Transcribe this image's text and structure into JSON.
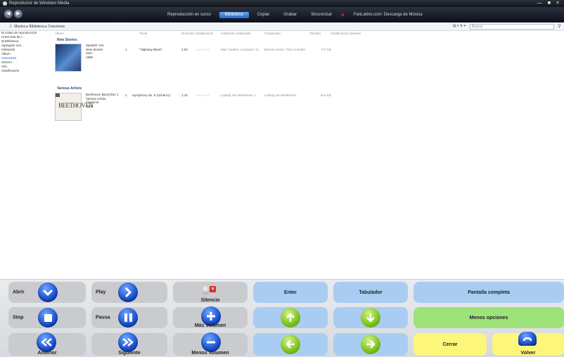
{
  "window": {
    "title": "Reproductor de Windows Media",
    "controls": "— ■ ×"
  },
  "nav": {
    "back": "◀",
    "forward": "▶",
    "tabs": [
      "Reproducción en curso",
      "Biblioteca",
      "Copiar",
      "Grabar",
      "Sincronizar"
    ],
    "active_tab": "Biblioteca",
    "store": "FanLatino.com: Descarga de Música"
  },
  "address": {
    "crumbs": "Música  ▸  Biblioteca  ▸  Canciones",
    "search_placeholder": "Buscar",
    "view_controls": "▤ ▾  ⇅ ▾"
  },
  "tree": {
    "items": [
      "⊟ Listas de reproducción",
      "   Crear lista de r...",
      "⊟ Biblioteca",
      "   Agregado reci...",
      "   Intérprete",
      "   Álbum",
      "   Canciones",
      "   Género",
      "   Año",
      "   Clasificación"
    ]
  },
  "columns": [
    "Álbum",
    "Título",
    "Duración",
    "Clasificación",
    "Intérprete colaborado",
    "Compositor",
    "Tamaño",
    "Clasificación parental"
  ],
  "groups": [
    {
      "name": "New Stories",
      "album_lines": [
        "Speakin' Out",
        "New Stories",
        "Jazz",
        "1999"
      ],
      "track": {
        "num": "1",
        "title": "\"Highway Blues\"",
        "duration": "1:33",
        "rating": "☆☆☆☆☆",
        "artist": "Marc Seales, composer. N...",
        "composer": "Bennie Green; Tony Crombie",
        "size": "747 KB"
      }
    },
    {
      "name": "Various Artists",
      "album_lines": [
        "Beethoven [Box] Disc 1",
        "Various Artists",
        "Classical",
        "2002"
      ],
      "track": {
        "num": "1",
        "title": "Symphony No. 9 (Scherzo)",
        "duration": "1:15",
        "rating": "☆☆☆☆☆",
        "artist": "Ludwig van Beethoven, c...",
        "composer": "Ludwig van Beethoven",
        "size": "619 KB"
      },
      "art_text": "BEETHOVEN"
    }
  ],
  "panel": {
    "abrir": "Abrir",
    "play": "Play",
    "silencio": "Silencio",
    "enter": "Enter",
    "tabulador": "Tabulador",
    "pantalla": "Pantalla completa",
    "stop": "Stop",
    "pausa": "Pausa",
    "mas_volumen": "Más Volumen",
    "menos_opciones": "Menos opciones",
    "anterior": "Anterior",
    "siguiente": "Siguiente",
    "menos_volumen": "Menos Volumen",
    "cerrar": "Cerrar",
    "volver": "Volver"
  },
  "colors": {
    "blue_button": "#a9cdf2",
    "green_button": "#9ee27a",
    "yellow_button": "#fcf77a",
    "gray_button": "#c9cbcf"
  }
}
